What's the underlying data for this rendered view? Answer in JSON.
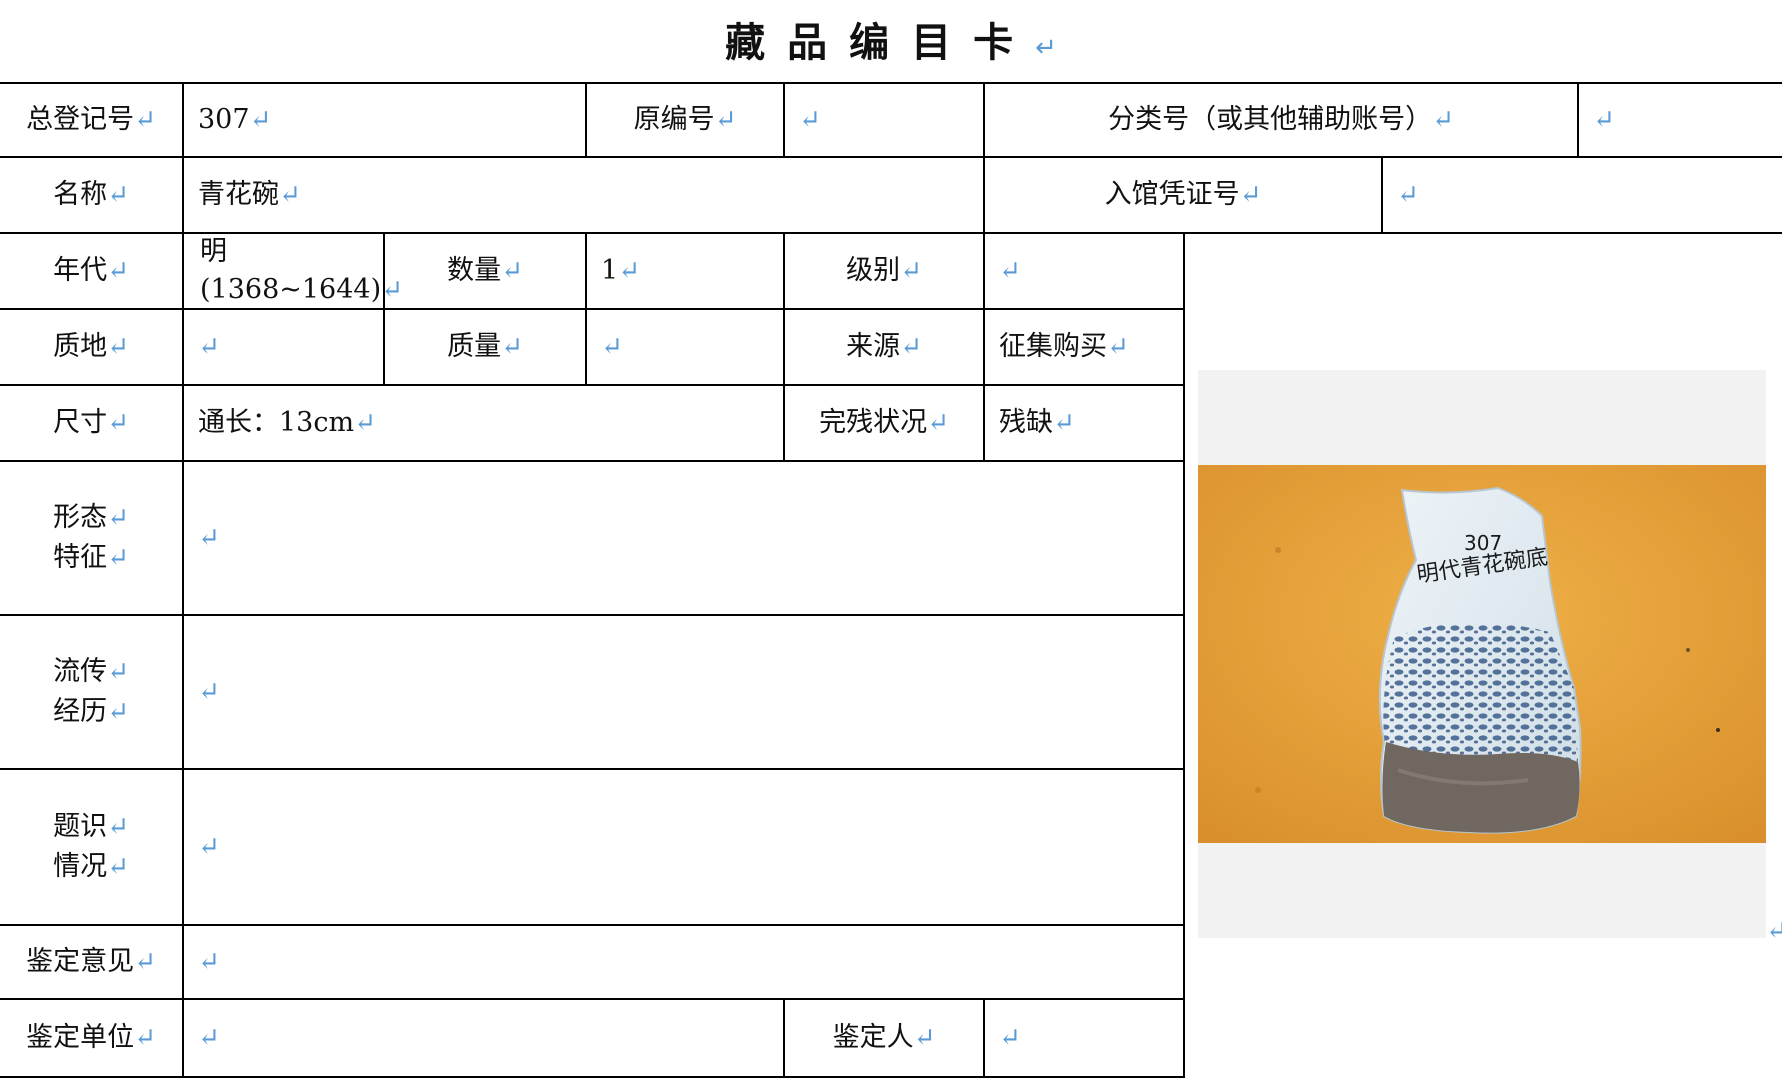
{
  "title": "藏品编目卡",
  "paragraph_mark": "↵",
  "labels": {
    "registry_no": "总登记号",
    "original_no": "原编号",
    "category_no": "分类号（或其他辅助账号）",
    "name": "名称",
    "voucher_no": "入馆凭证号",
    "era": "年代",
    "quantity": "数量",
    "grade": "级别",
    "material": "质地",
    "weight": "质量",
    "source": "来源",
    "size": "尺寸",
    "condition": "完残状况",
    "morphology_1": "形态",
    "morphology_2": "特征",
    "provenance_1": "流传",
    "provenance_2": "经历",
    "inscription_1": "题识",
    "inscription_2": "情况",
    "appraisal_opinion": "鉴定意见",
    "appraisal_unit": "鉴定单位",
    "appraiser": "鉴定人"
  },
  "values": {
    "registry_no": "307",
    "original_no": "",
    "category_no": "",
    "name": "青花碗",
    "voucher_no": "",
    "era_line1": "明",
    "era_line2": "(1368~1644)",
    "quantity": "1",
    "grade": "",
    "material": "",
    "weight": "",
    "source": "征集购买",
    "size": "通长：13cm",
    "condition": "残缺",
    "morphology": "",
    "provenance": "",
    "inscription": "",
    "appraisal_opinion": "",
    "appraisal_unit": "",
    "appraiser": ""
  },
  "photo": {
    "handwriting_line1": "307",
    "handwriting_line2": "明代青花碗底",
    "colors": {
      "background": "#e9a23b",
      "porcelain": "#dfe9ef",
      "pattern": "#3c5e8c",
      "soil": "#6f6760"
    }
  }
}
